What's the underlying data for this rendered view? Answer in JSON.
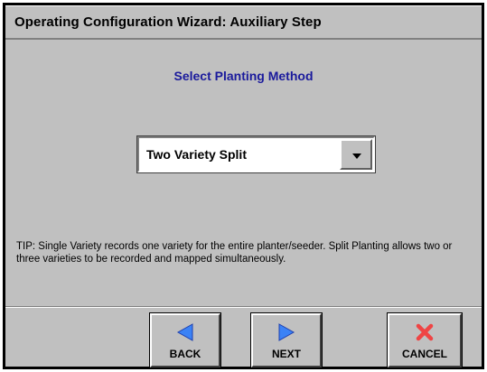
{
  "window": {
    "title": "Operating Configuration Wizard:  Auxiliary Step"
  },
  "main": {
    "heading": "Select Planting Method",
    "planting_method": {
      "selected": "Two Variety Split"
    },
    "tip": "TIP:  Single Variety records one variety for the entire planter/seeder.  Split Planting allows two or three varieties to be recorded and mapped simultaneously."
  },
  "footer": {
    "back_label": "BACK",
    "next_label": "NEXT",
    "cancel_label": "CANCEL"
  },
  "colors": {
    "panel": "#c0c0c0",
    "heading": "#1a1a9c",
    "nav_arrow": "#3b82f6",
    "cancel_x": "#ef4444"
  },
  "icons": {
    "back": "arrow-left-icon",
    "next": "arrow-right-icon",
    "cancel": "x-icon",
    "dropdown": "caret-down-icon"
  }
}
